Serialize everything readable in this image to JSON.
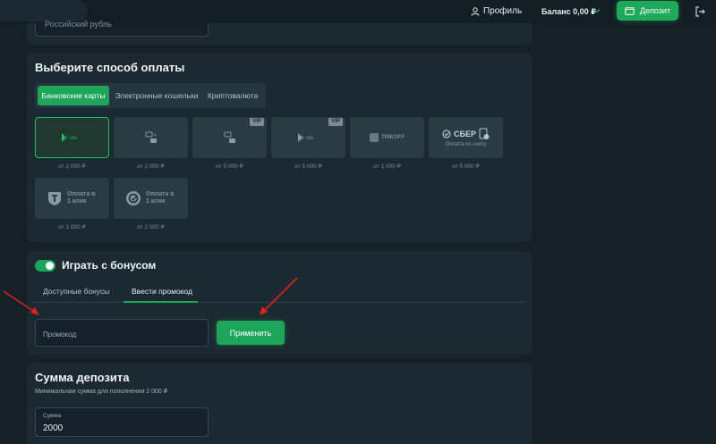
{
  "header": {
    "profile_label": "Профиль",
    "balance_label": "Баланс 0,00 ₽",
    "deposit_label": "Депозит"
  },
  "top": {
    "currency_value": "Российский рубль"
  },
  "payment": {
    "title": "Выберите способ оплаты",
    "tabs": [
      {
        "label": "Банковские карты",
        "active": true
      },
      {
        "label": "Электронные кошельки",
        "active": false
      },
      {
        "label": "Криптовалюта",
        "active": false
      }
    ],
    "methods": [
      {
        "icon": "sbp-logo-icon",
        "min": "от 2 000 ₽",
        "selected": true,
        "vip": false
      },
      {
        "icon": "card-transfer-icon",
        "min": "от 2 000 ₽",
        "selected": false,
        "vip": false
      },
      {
        "icon": "card-transfer-vip-icon",
        "min": "от 5 000 ₽",
        "selected": false,
        "vip": true,
        "vip_label": "VIP"
      },
      {
        "icon": "sbp-vip-logo-icon",
        "min": "от 5 000 ₽",
        "selected": false,
        "vip": true,
        "vip_label": "VIP"
      },
      {
        "icon": "tinkoff-logo-icon",
        "name": "TINKOFF",
        "min": "от 1 000 ₽",
        "selected": false,
        "vip": false
      },
      {
        "icon": "sber-logo-icon",
        "name": "СБЕР",
        "caption": "Оплата по счету",
        "min": "от 5 000 ₽",
        "selected": false,
        "vip": false
      },
      {
        "icon": "tbank-logo-icon",
        "name": "Оплата в 1 клик",
        "min": "от 1 000 ₽",
        "selected": false,
        "vip": false
      },
      {
        "icon": "yoomoney-logo-icon",
        "name": "Оплата в 1 клик",
        "min": "от 2 000 ₽",
        "selected": false,
        "vip": false
      }
    ]
  },
  "bonus": {
    "title": "Играть с бонусом",
    "toggle_on": true,
    "tabs": [
      {
        "label": "Доступные бонусы",
        "active": false
      },
      {
        "label": "Ввести промокод",
        "active": true
      }
    ],
    "promo_placeholder": "Промокод",
    "apply_label": "Применить"
  },
  "sum": {
    "title": "Сумма депозита",
    "subtitle": "Минимальная сумма для пополнения 2 000 ₽",
    "field_label": "Сумма",
    "field_value": "2000"
  },
  "colors": {
    "accent": "#1ea55a",
    "background": "#142127",
    "panel": "#1b2a31",
    "annotation_arrow": "#e0201c"
  }
}
